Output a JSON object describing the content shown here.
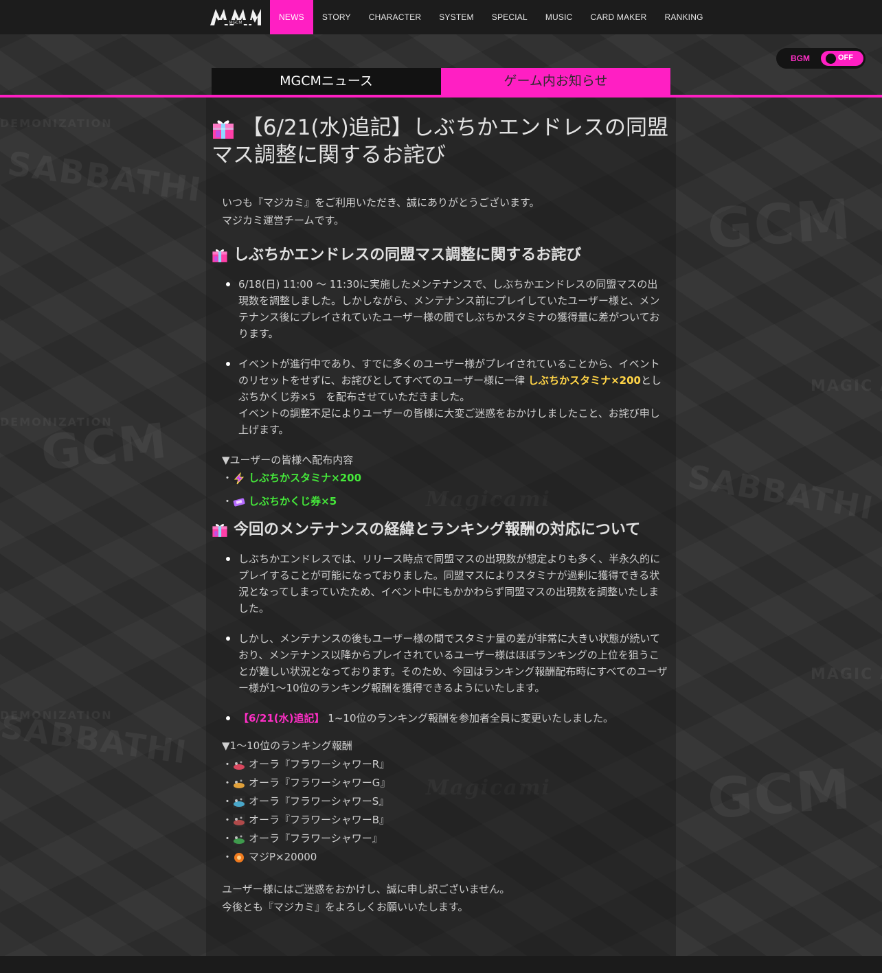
{
  "header": {
    "logo_text": "MGCM",
    "nav": [
      "NEWS",
      "STORY",
      "CHARACTER",
      "SYSTEM",
      "SPECIAL",
      "MUSIC",
      "CARD MAKER",
      "RANKING"
    ],
    "active_nav": "NEWS"
  },
  "bgm": {
    "label": "BGM",
    "state": "OFF"
  },
  "tabs": {
    "left": "MGCMニュース",
    "right": "ゲーム内お知らせ"
  },
  "background_words": [
    "SABBATHI",
    "GCM",
    "MAGIC A",
    "DEMONIZATION",
    "Magicami"
  ],
  "article": {
    "title": "【6/21(水)追記】しぶちかエンドレスの同盟マス調整に関するお詫び",
    "intro": [
      "いつも『マジカミ』をご利用いただき、誠にありがとうございます。",
      "マジカミ運営チームです。"
    ],
    "section1": {
      "heading": "しぶちかエンドレスの同盟マス調整に関するお詫び",
      "b1": "6/18(日) 11:00 〜 11:30に実施したメンテナンスで、しぶちかエンドレスの同盟マスの出現数を調整しました。しかしながら、メンテナンス前にプレイしていたユーザー様と、メンテナンス後にプレイされていたユーザー様の間でしぶちかスタミナの獲得量に差がついております。",
      "b2_pre": "イベントが進行中であり、すでに多くのユーザー様がプレイされていることから、イベントのリセットをせずに、お詫びとしてすべてのユーザー様に一律 ",
      "b2_highlight": "しぶちかスタミナ×200",
      "b2_post": "としぶちかくじ券×5　を配布させていただきました。",
      "b2_line2": "イベントの調整不足によりユーザーの皆様に大変ご迷惑をおかけしましたこと、お詫び申し上げます。",
      "dist_heading": "▼ユーザーの皆様へ配布内容",
      "dist_items": [
        "しぶちかスタミナ×200",
        "しぶちかくじ券×5"
      ]
    },
    "section2": {
      "heading": "今回のメンテナンスの経緯とランキング報酬の対応について",
      "b1": "しぶちかエンドレスでは、リリース時点で同盟マスの出現数が想定よりも多く、半永久的にプレイすることが可能になっておりました。同盟マスによりスタミナが過剰に獲得できる状況となってしまっていたため、イベント中にもかかわらず同盟マスの出現数を調整いたしました。",
      "b2": "しかし、メンテナンスの後もユーザー様の間でスタミナ量の差が非常に大きい状態が続いており、メンテナンス以降からプレイされているユーザー様はほぼランキングの上位を狙うことが難しい状況となっております。そのため、今回はランキング報酬配布時にすべてのユーザー様が1〜10位のランキング報酬を獲得できるようにいたします。",
      "b3_highlight": "【6/21(水)追記】",
      "b3_text": " 1~10位のランキング報酬を参加者全員に変更いたしました。",
      "reward_heading": "▼1〜10位のランキング報酬",
      "rewards": [
        {
          "label": "オーラ『フラワーシャワーR』",
          "color": "#d9475e"
        },
        {
          "label": "オーラ『フラワーシャワーG』",
          "color": "#e0a03a"
        },
        {
          "label": "オーラ『フラワーシャワーS』",
          "color": "#4aa7c9"
        },
        {
          "label": "オーラ『フラワーシャワーB』",
          "color": "#b04a4a"
        },
        {
          "label": "オーラ『フラワーシャワー』",
          "color": "#3f9a4d"
        },
        {
          "label": "マジP×20000",
          "color": "#f07b1f"
        }
      ]
    },
    "outro": [
      "ユーザー様にはご迷惑をおかけし、誠に申し訳ございません。",
      "今後とも『マジカミ』をよろしくお願いいたします。"
    ]
  },
  "colors": {
    "accent": "#ff1fc3",
    "highlight_yellow": "#ffd447",
    "highlight_green": "#45e83a"
  }
}
